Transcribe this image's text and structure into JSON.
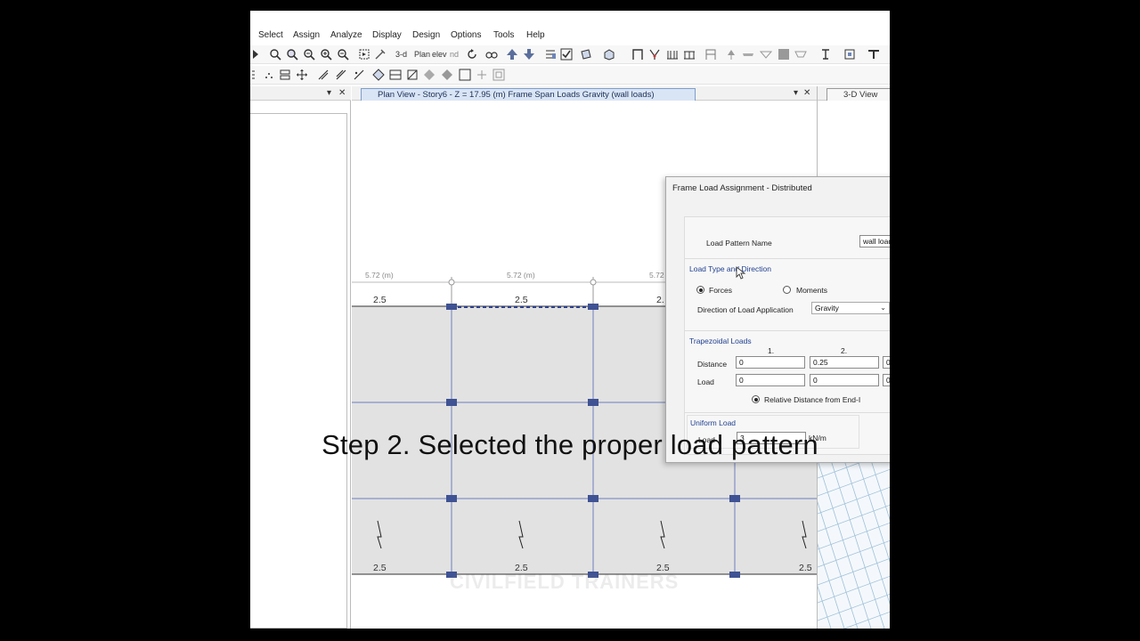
{
  "menu": [
    "Select",
    "Assign",
    "Analyze",
    "Display",
    "Design",
    "Options",
    "Tools",
    "Help"
  ],
  "toolbar": {
    "text_3d": "3-d",
    "text_plan": "Plan",
    "text_elev": "elev",
    "text_nd": "nd"
  },
  "plan_view": {
    "title": "Plan View - Story6 - Z = 17.95 (m)  Frame Span Loads Gravity (wall loads)",
    "span_labels": [
      "5.72 (m)",
      "5.72 (m)",
      "5.72"
    ],
    "load_values_top": [
      "2.5",
      "2.5",
      "2."
    ],
    "load_values_bottom": [
      "2.5",
      "2.5",
      "2.5",
      "2.5"
    ]
  },
  "view3d": {
    "title": "3-D View"
  },
  "window_controls": {
    "dropdown": "▾",
    "close": "✕"
  },
  "dialog": {
    "title": "Frame Load Assignment - Distributed",
    "load_pattern_label": "Load Pattern Name",
    "load_pattern_value": "wall loads",
    "group_load_type": "Load Type and Direction",
    "radio_forces": "Forces",
    "radio_moments": "Moments",
    "direction_label": "Direction of Load Application",
    "direction_value": "Gravity",
    "group_trapezoidal": "Trapezoidal Loads",
    "col_1": "1.",
    "col_2": "2.",
    "distance_label": "Distance",
    "load_label": "Load",
    "distance_values": [
      "0",
      "0.25",
      "0."
    ],
    "load_values": [
      "0",
      "0",
      "0"
    ],
    "relative_distance_label": "Relative Distance from End-I",
    "group_uniform": "Uniform Load",
    "uniform_load_label": "Load",
    "uniform_load_value": "3",
    "uniform_unit": "kN/m"
  },
  "caption": "Step 2. Selected the proper load pattern",
  "watermark": "CIVILFIELD TRAINERS"
}
